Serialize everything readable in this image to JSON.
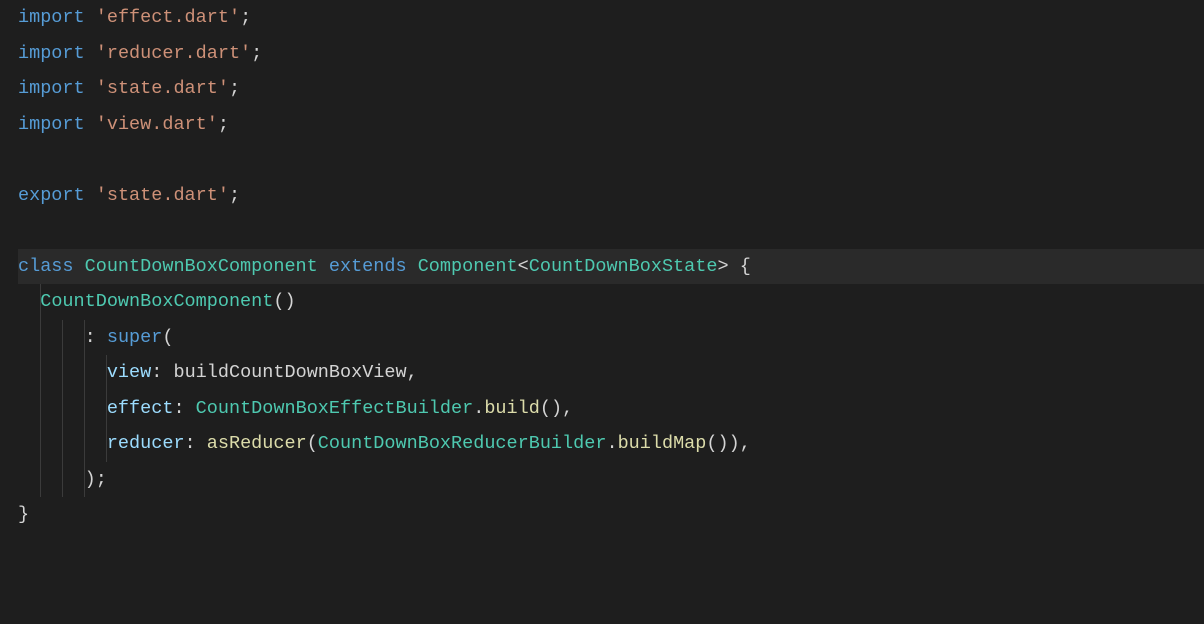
{
  "code": {
    "tokens": {
      "import": "import",
      "export": "export",
      "class": "class",
      "extends": "extends",
      "super": "super"
    },
    "imports": {
      "effect": "'effect.dart'",
      "reducer": "'reducer.dart'",
      "state": "'state.dart'",
      "view": "'view.dart'"
    },
    "exports": {
      "state": "'state.dart'"
    },
    "types": {
      "component_class": "CountDownBoxComponent",
      "base_class": "Component",
      "state_type": "CountDownBoxState",
      "effect_builder": "CountDownBoxEffectBuilder",
      "reducer_builder": "CountDownBoxReducerBuilder"
    },
    "identifiers": {
      "view_fn": "buildCountDownBoxView",
      "as_reducer": "asReducer",
      "build_method": "build",
      "build_map_method": "buildMap"
    },
    "params": {
      "view": "view",
      "effect": "effect",
      "reducer": "reducer"
    },
    "punct": {
      "semi": ";",
      "colon": ":",
      "comma": ",",
      "lparen": "(",
      "rparen": ")",
      "lbrace": "{",
      "rbrace": "}",
      "lt": "<",
      "gt": ">",
      "dot": "."
    },
    "space": " "
  }
}
